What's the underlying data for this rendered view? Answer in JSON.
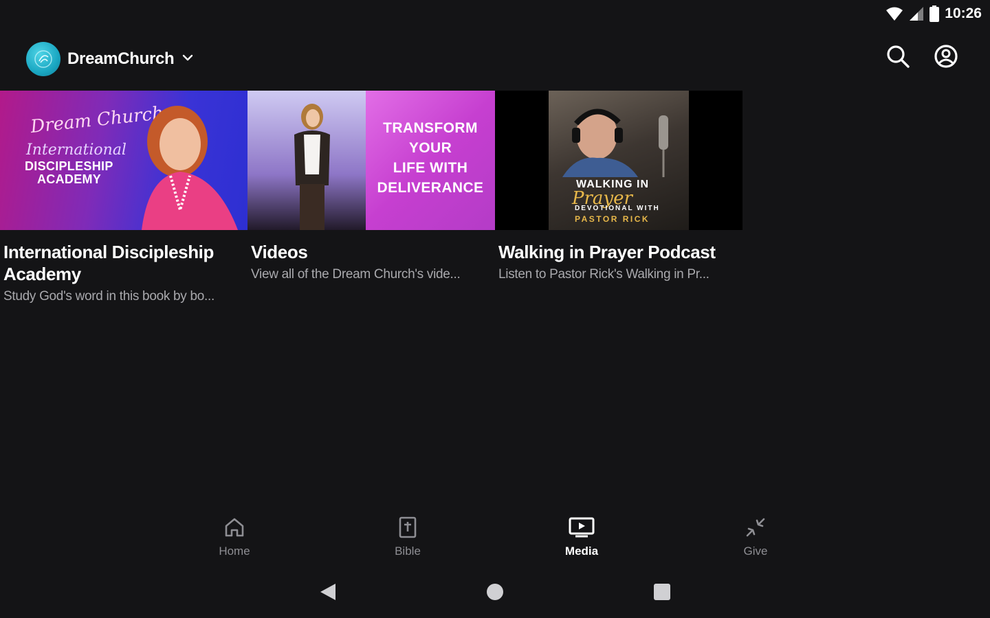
{
  "status_bar": {
    "time": "10:26"
  },
  "header": {
    "brand_name": "DreamChurch"
  },
  "media_cards": [
    {
      "title": "International Discipleship Academy",
      "description": "Study God's word in this book by bo...",
      "thumbnail_text": {
        "line1": "Dream Church",
        "line2": "International",
        "line3": "DISCIPLESHIP",
        "line4": "ACADEMY"
      }
    },
    {
      "title": "Videos",
      "description": "View all of the Dream Church's vide...",
      "thumbnail_text": {
        "line1": "TRANSFORM",
        "line2": "YOUR",
        "line3": "LIFE WITH",
        "line4": "DELIVERANCE"
      }
    },
    {
      "title": "Walking in Prayer Podcast",
      "description": "Listen to Pastor Rick's Walking in Pr...",
      "thumbnail_text": {
        "line1": "WALKING IN",
        "line2": "Prayer",
        "line3": "DEVOTIONAL WITH",
        "line4": "PASTOR RICK"
      }
    }
  ],
  "bottom_nav": {
    "items": [
      {
        "label": "Home",
        "icon": "home-icon",
        "active": false
      },
      {
        "label": "Bible",
        "icon": "bible-icon",
        "active": false
      },
      {
        "label": "Media",
        "icon": "media-icon",
        "active": true
      },
      {
        "label": "Give",
        "icon": "give-icon",
        "active": false
      }
    ]
  },
  "colors": {
    "background": "#141416",
    "text_primary": "#ffffff",
    "text_secondary": "#a9a9ad",
    "nav_inactive": "#8e8e93",
    "brand_accent": "#1aa7c2"
  }
}
